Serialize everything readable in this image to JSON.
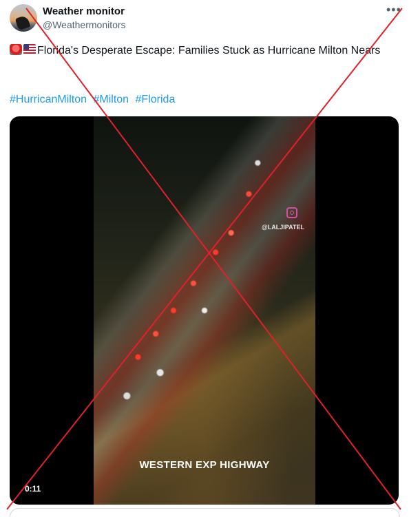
{
  "author": {
    "name": "Weather monitor",
    "handle": "@Weathermonitors"
  },
  "post": {
    "emoji": [
      "police-light-emoji",
      "us-flag-emoji"
    ],
    "text": "Florida's Desperate Escape: Families Stuck as Hurricane Milton Nears",
    "hashtags": [
      "#HurricanMilton",
      "#Milton",
      "#Florida"
    ]
  },
  "media": {
    "watermark": "@LALJIPATEL",
    "caption": "WESTERN EXP HIGHWAY",
    "duration": "0:11"
  },
  "icons": {
    "more": "more-dots-icon",
    "social": "instagram-icon"
  },
  "colors": {
    "link": "#1d9bf0",
    "cross": "#e0202a"
  }
}
